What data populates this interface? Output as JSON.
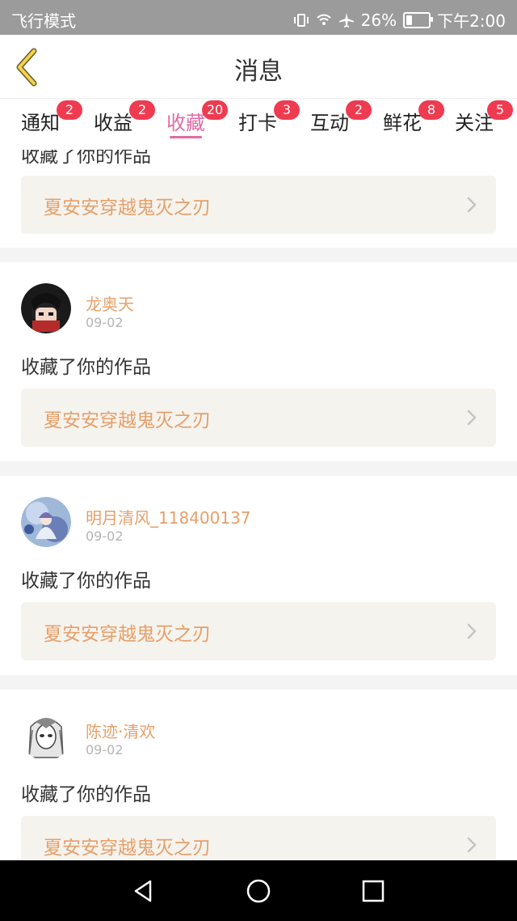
{
  "status_bar": {
    "mode": "飞行模式",
    "battery": "26%",
    "battery_level": 0.26,
    "time": "下午2:00"
  },
  "header": {
    "title": "消息",
    "back_icon": "chevron-left-icon"
  },
  "tabs": [
    {
      "label": "通知",
      "badge": "2",
      "active": false
    },
    {
      "label": "收益",
      "badge": "2",
      "active": false
    },
    {
      "label": "收藏",
      "badge": "20",
      "active": true
    },
    {
      "label": "打卡",
      "badge": "3",
      "active": false
    },
    {
      "label": "互动",
      "badge": "2",
      "active": false
    },
    {
      "label": "鲜花",
      "badge": "8",
      "active": false
    },
    {
      "label": "关注",
      "badge": "5",
      "active": false
    }
  ],
  "feed": {
    "partial_action_text": "收藏了你的作品",
    "partial_work": "夏安安穿越鬼灭之刃",
    "items": [
      {
        "user": "龙奥天",
        "date": "09-02",
        "action": "收藏了你的作品",
        "work": "夏安安穿越鬼灭之刃"
      },
      {
        "user": "明月清风_118400137",
        "date": "09-02",
        "action": "收藏了你的作品",
        "work": "夏安安穿越鬼灭之刃"
      },
      {
        "user": "陈迹·清欢",
        "date": "09-02",
        "action": "收藏了你的作品",
        "work": "夏安安穿越鬼灭之刃"
      }
    ]
  },
  "colors": {
    "accent_pink": "#e06aa6",
    "badge_red": "#ef3b50",
    "orange_text": "#e6a06a",
    "work_bar_bg": "#f5f3ee"
  },
  "nav": {
    "back": "triangle-back-icon",
    "home": "circle-home-icon",
    "recent": "square-recent-icon"
  }
}
